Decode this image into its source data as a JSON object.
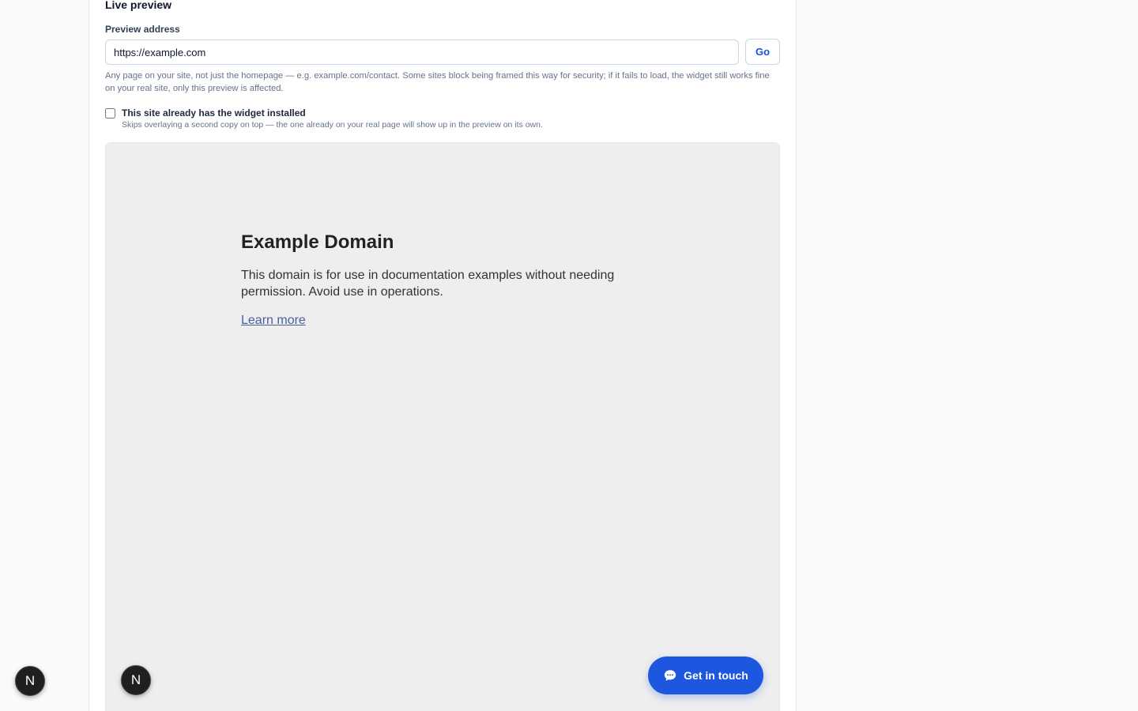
{
  "live_preview": {
    "section_title": "Live preview",
    "address_label": "Preview address",
    "address_value": "https://example.com",
    "go_label": "Go",
    "help_text": "Any page on your site, not just the homepage — e.g. example.com/contact. Some sites block being framed this way for security; if it fails to load, the widget still works fine on your real site, only this preview is affected.",
    "installed_checkbox": {
      "label": "This site already has the widget installed",
      "description": "Skips overlaying a second copy on top — the one already on your real page will show up in the preview on its own.",
      "checked": false
    }
  },
  "preview_page": {
    "title": "Example Domain",
    "body": "This domain is for use in documentation examples without needing permission. Avoid use in operations.",
    "link": "Learn more"
  },
  "widget": {
    "button_label": "Get in touch",
    "icon": "chat-bubble-icon",
    "color": "#1d57e0"
  },
  "badges": {
    "inner_letter": "N",
    "outer_letter": "N"
  }
}
